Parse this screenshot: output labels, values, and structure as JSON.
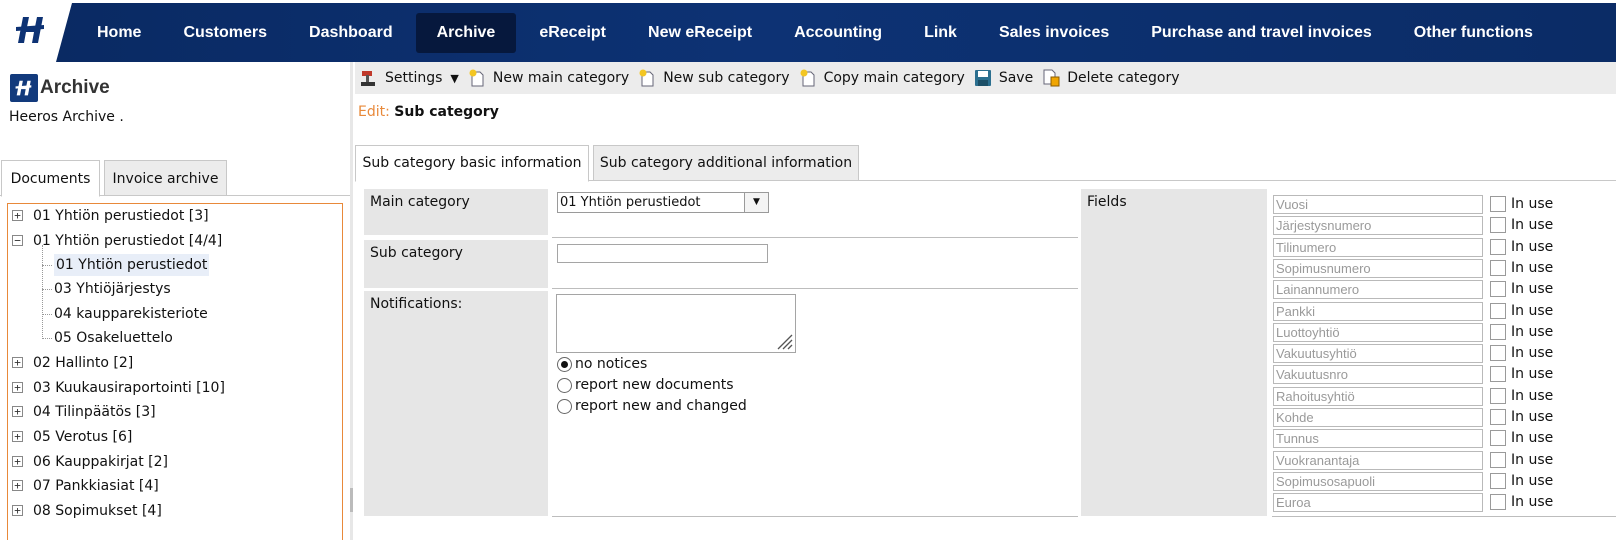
{
  "nav": {
    "items": [
      "Home",
      "Customers",
      "Dashboard",
      "Archive",
      "eReceipt",
      "New eReceipt",
      "Accounting",
      "Link",
      "Sales invoices",
      "Purchase and travel invoices",
      "Other functions"
    ],
    "active": "Archive",
    "colors": {
      "band": "#0d3274",
      "active": "#06183d",
      "accent": "#e8893a"
    }
  },
  "sidebar": {
    "title": "Archive",
    "company": "Heeros Archive  .",
    "tabs": [
      "Documents",
      "Invoice archive"
    ],
    "tree": [
      {
        "label": "01 Yhtiön perustiedot [3]",
        "expander": "+"
      },
      {
        "label": "01 Yhtiön perustiedot [4/4]",
        "expander": "−"
      },
      {
        "label": "01 Yhtiön perustiedot",
        "child": true,
        "selected": true
      },
      {
        "label": "03 Yhtiöjärjestys",
        "child": true
      },
      {
        "label": "04 kaupparekisteriote",
        "child": true
      },
      {
        "label": "05 Osakeluettelo",
        "child": true
      },
      {
        "label": "02 Hallinto [2]",
        "expander": "+"
      },
      {
        "label": "03 Kuukausiraportointi [10]",
        "expander": "+"
      },
      {
        "label": "04 Tilinpäätös [3]",
        "expander": "+"
      },
      {
        "label": "05 Verotus [6]",
        "expander": "+"
      },
      {
        "label": "06 Kauppakirjat [2]",
        "expander": "+"
      },
      {
        "label": "07 Pankkiasiat [4]",
        "expander": "+"
      },
      {
        "label": "08 Sopimukset [4]",
        "expander": "+"
      }
    ]
  },
  "toolbar": {
    "settings": "Settings",
    "new_main": "New main category",
    "new_sub": "New sub category",
    "copy_main": "Copy main category",
    "save": "Save",
    "delete": "Delete category"
  },
  "edit": {
    "prefix": "Edit:",
    "title": "Sub category"
  },
  "tabs": [
    "Sub category basic information",
    "Sub category additional information"
  ],
  "form": {
    "main_category_label": "Main category",
    "main_category_value": "01 Yhtiön perustiedot",
    "sub_category_label": "Sub category",
    "sub_category_value": "",
    "notifications_label": "Notifications:",
    "radio_options": [
      "no notices",
      "report new documents",
      "report new and changed"
    ],
    "radio_selected": "no notices"
  },
  "fields": {
    "label": "Fields",
    "in_use_label": "In use",
    "items": [
      "Vuosi",
      "Järjestysnumero",
      "Tilinumero",
      "Sopimusnumero",
      "Lainannumero",
      "Pankki",
      "Luottoyhtiö",
      "Vakuutusyhtiö",
      "Vakuutusnro",
      "Rahoitusyhtiö",
      "Kohde",
      "Tunnus",
      "Vuokranantaja",
      "Sopimusosapuoli",
      "Euroa"
    ]
  }
}
